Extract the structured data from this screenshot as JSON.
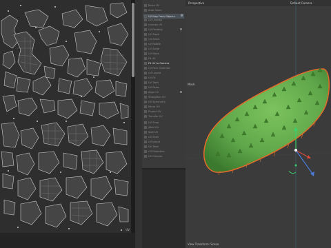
{
  "uv_editor": {
    "corner_label": "UV",
    "scroll_position_fraction": 0.02
  },
  "tool_menu": {
    "items": [
      {
        "label": "Relax UV",
        "state": "normal"
      },
      {
        "label": "Auto Seam",
        "state": "normal"
      },
      {
        "label": "Seam UV",
        "state": "normal"
      },
      {
        "label": "UV Unwrap",
        "state": "normal"
      },
      {
        "label": "Unwrap UV",
        "state": "normal"
      },
      {
        "label": "UV Map From Objects",
        "state": "highlight"
      },
      {
        "label": "UV Padding",
        "state": "normal"
      },
      {
        "label": "UV Stack",
        "state": "normal"
      },
      {
        "label": "UV Stitch",
        "state": "normal"
      },
      {
        "label": "UV Rotate",
        "state": "normal"
      },
      {
        "label": "UV Scale",
        "state": "normal"
      },
      {
        "label": "UV Move",
        "state": "normal"
      },
      {
        "label": "Fit UV",
        "state": "normal"
      },
      {
        "label": "UV Pack Optimize",
        "state": "normal"
      },
      {
        "label": "UV Layout",
        "state": "normal"
      },
      {
        "label": "UV Fit",
        "state": "normal"
      },
      {
        "label": "Fit UV to Camera",
        "state": "bright"
      },
      {
        "label": "UV Tools",
        "state": "normal"
      },
      {
        "label": "UV Relax",
        "state": "normal"
      },
      {
        "label": "Align UV",
        "state": "normal"
      },
      {
        "label": "Straighten UV",
        "state": "normal"
      },
      {
        "label": "UV Symmetry",
        "state": "normal"
      },
      {
        "label": "Mirror UV",
        "state": "normal"
      },
      {
        "label": "Project UV",
        "state": "normal"
      },
      {
        "label": "Transfer UV",
        "state": "normal"
      },
      {
        "label": "UV Snap",
        "state": "normal"
      },
      {
        "label": "Weld UV",
        "state": "normal"
      },
      {
        "label": "Split UV",
        "state": "normal"
      },
      {
        "label": "UV Shell",
        "state": "normal"
      },
      {
        "label": "UV Island",
        "state": "normal"
      },
      {
        "label": "UV Texel",
        "state": "normal"
      },
      {
        "label": "UV Distortion",
        "state": "normal"
      },
      {
        "label": "UV Checker",
        "state": "normal"
      }
    ]
  },
  "viewport": {
    "name_label": "Perspective",
    "camera_label": "Default Camera",
    "object_label": "Mesh",
    "status_text": "View Transform: Scene",
    "colors": {
      "object_fill": "#5fa64a",
      "selection_outline": "#e06a2a",
      "axis_x": "#d84a3a",
      "axis_y": "#3ad06a",
      "axis_z": "#4a7ad8"
    }
  }
}
